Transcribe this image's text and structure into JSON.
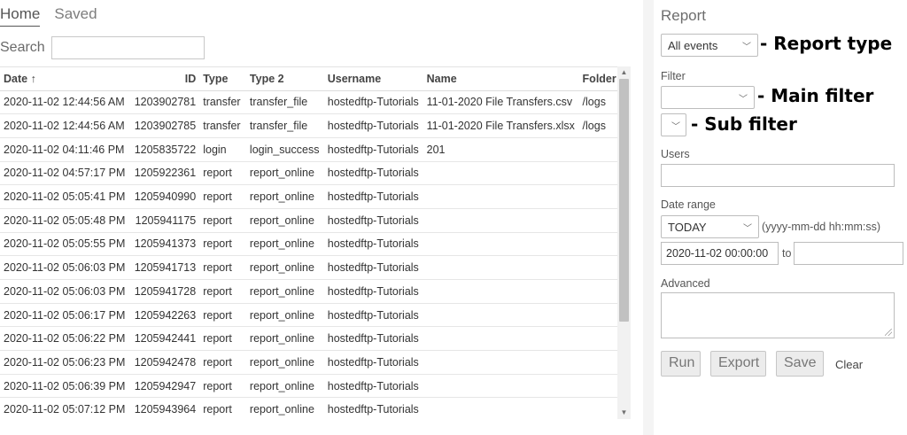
{
  "tabs": [
    {
      "label": "Home",
      "active": true
    },
    {
      "label": "Saved",
      "active": false
    }
  ],
  "search": {
    "label": "Search",
    "value": ""
  },
  "table": {
    "columns": [
      "Date ↑",
      "ID",
      "Type",
      "Type 2",
      "Username",
      "Name",
      "Folder"
    ],
    "rows": [
      [
        "2020-11-02 12:44:56 AM",
        "1203902781",
        "transfer",
        "transfer_file",
        "hostedftp-Tutorials",
        "11-01-2020 File Transfers.csv",
        "/logs"
      ],
      [
        "2020-11-02 12:44:56 AM",
        "1203902785",
        "transfer",
        "transfer_file",
        "hostedftp-Tutorials",
        "11-01-2020 File Transfers.xlsx",
        "/logs"
      ],
      [
        "2020-11-02 04:11:46 PM",
        "1205835722",
        "login",
        "login_success",
        "hostedftp-Tutorials",
        "201",
        ""
      ],
      [
        "2020-11-02 04:57:17 PM",
        "1205922361",
        "report",
        "report_online",
        "hostedftp-Tutorials",
        "",
        ""
      ],
      [
        "2020-11-02 05:05:41 PM",
        "1205940990",
        "report",
        "report_online",
        "hostedftp-Tutorials",
        "",
        ""
      ],
      [
        "2020-11-02 05:05:48 PM",
        "1205941175",
        "report",
        "report_online",
        "hostedftp-Tutorials",
        "",
        ""
      ],
      [
        "2020-11-02 05:05:55 PM",
        "1205941373",
        "report",
        "report_online",
        "hostedftp-Tutorials",
        "",
        ""
      ],
      [
        "2020-11-02 05:06:03 PM",
        "1205941713",
        "report",
        "report_online",
        "hostedftp-Tutorials",
        "",
        ""
      ],
      [
        "2020-11-02 05:06:03 PM",
        "1205941728",
        "report",
        "report_online",
        "hostedftp-Tutorials",
        "",
        ""
      ],
      [
        "2020-11-02 05:06:17 PM",
        "1205942263",
        "report",
        "report_online",
        "hostedftp-Tutorials",
        "",
        ""
      ],
      [
        "2020-11-02 05:06:22 PM",
        "1205942441",
        "report",
        "report_online",
        "hostedftp-Tutorials",
        "",
        ""
      ],
      [
        "2020-11-02 05:06:23 PM",
        "1205942478",
        "report",
        "report_online",
        "hostedftp-Tutorials",
        "",
        ""
      ],
      [
        "2020-11-02 05:06:39 PM",
        "1205942947",
        "report",
        "report_online",
        "hostedftp-Tutorials",
        "",
        ""
      ],
      [
        "2020-11-02 05:07:12 PM",
        "1205943964",
        "report",
        "report_online",
        "hostedftp-Tutorials",
        "",
        ""
      ]
    ]
  },
  "report": {
    "title": "Report",
    "report_type": {
      "selected": "All events",
      "annotation": "- Report type"
    },
    "filter": {
      "label": "Filter",
      "main_selected": "",
      "main_annotation": "- Main filter",
      "sub_selected": "",
      "sub_annotation": "- Sub filter"
    },
    "users": {
      "label": "Users",
      "value": ""
    },
    "date_range": {
      "label": "Date range",
      "selected": "TODAY",
      "format_hint": "(yyyy-mm-dd hh:mm:ss)",
      "from": "2020-11-02 00:00:00",
      "to_label": "to",
      "to": ""
    },
    "advanced": {
      "label": "Advanced",
      "value": ""
    },
    "buttons": {
      "run": "Run",
      "export": "Export",
      "save": "Save",
      "clear": "Clear"
    }
  },
  "icons": {
    "sort": "arrow-up-icon",
    "dropdown": "chevron-down-icon",
    "scroll_up": "triangle-up-icon",
    "scroll_down": "triangle-down-icon"
  }
}
